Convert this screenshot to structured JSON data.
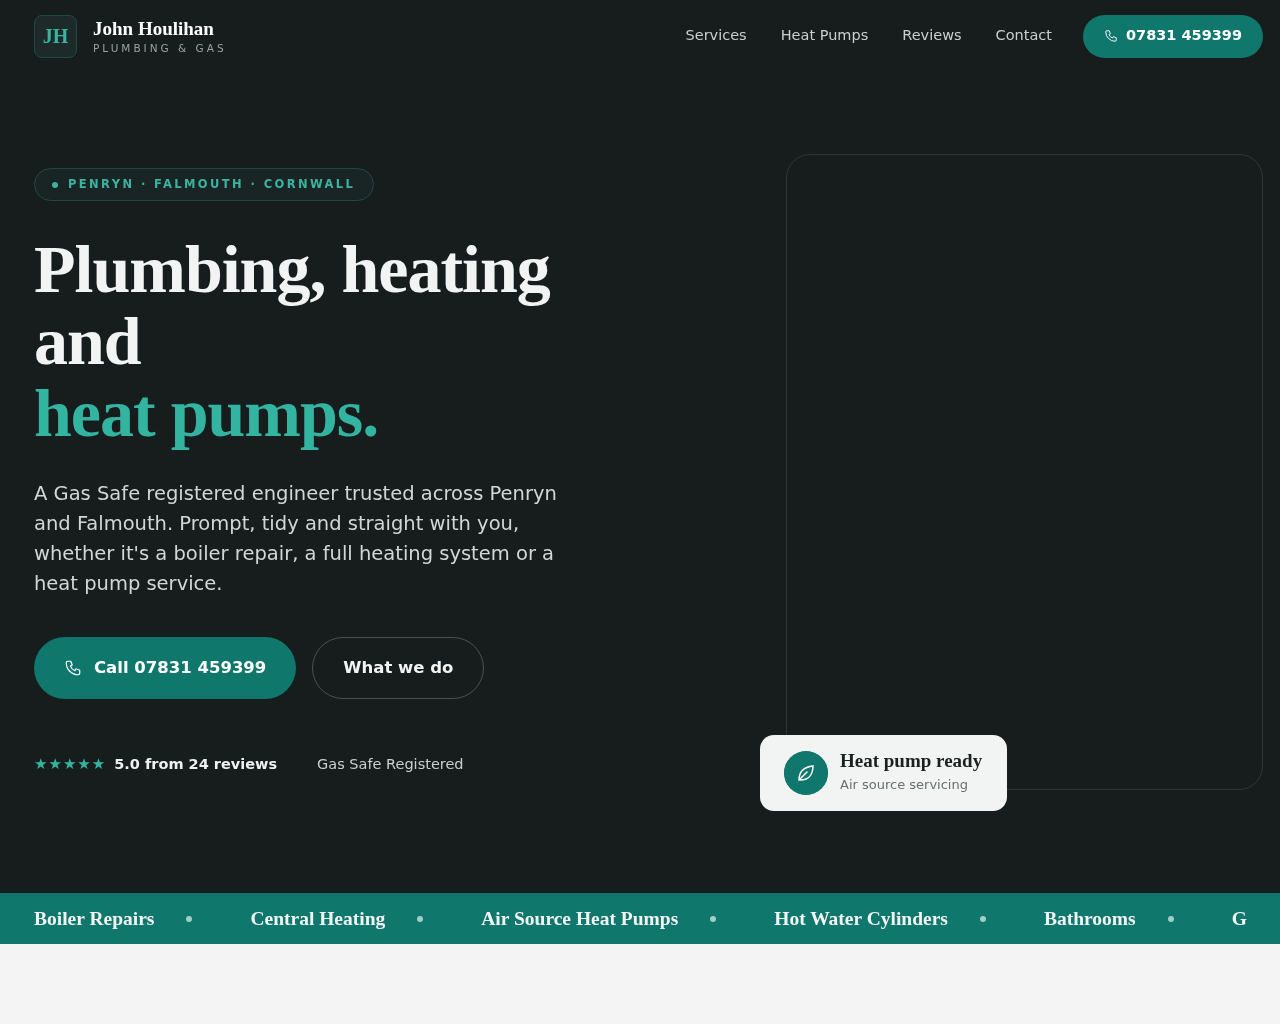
{
  "brand": {
    "monogram": "JH",
    "name": "John Houlihan",
    "tagline": "PLUMBING & GAS"
  },
  "nav": {
    "links": [
      "Services",
      "Heat Pumps",
      "Reviews",
      "Contact"
    ],
    "phone_button": "07831 459399"
  },
  "hero": {
    "location_pill": "PENRYN · FALMOUTH · CORNWALL",
    "headline": "Plumbing, heating and",
    "headline_accent": "heat pumps.",
    "intro": "A Gas Safe registered engineer trusted across Penryn and Falmouth. Prompt, tidy and straight with you, whether it's a boiler repair, a full heating system or a heat pump service.",
    "buttons": [
      {
        "kind": "primary",
        "label": "Call 07831 459399"
      },
      {
        "kind": "outline",
        "label": "What we do"
      }
    ],
    "rating": {
      "stars": 5,
      "text": "5.0 from 24 reviews"
    },
    "credential": "Gas Safe Registered",
    "floating_card": {
      "title": "Heat pump ready",
      "subtitle": "Air source servicing"
    }
  },
  "ticker": [
    "Boiler Repairs",
    "Central Heating",
    "Air Source Heat Pumps",
    "Hot Water Cylinders",
    "Bathrooms",
    "G"
  ]
}
